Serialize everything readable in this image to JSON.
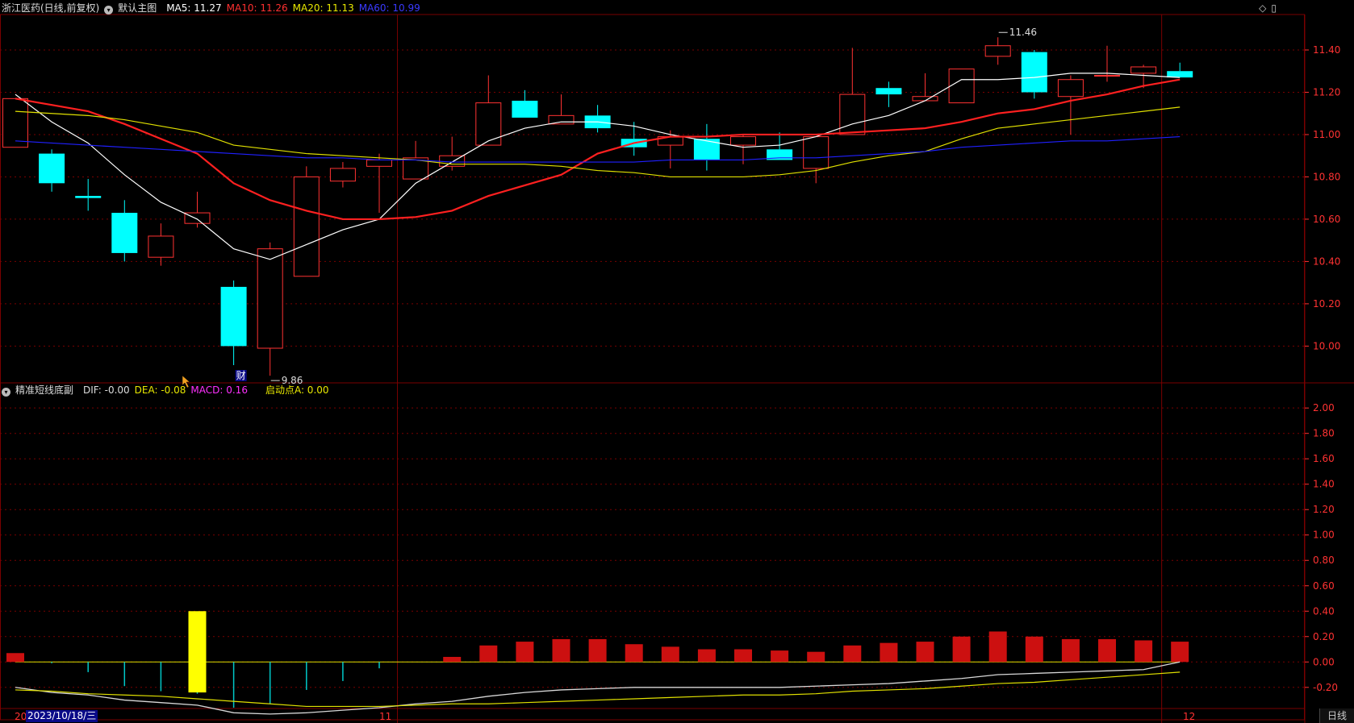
{
  "header": {
    "stock_name": "浙江医药(日线,前复权)",
    "main_chart_label": "默认主图",
    "ma5": "MA5: 11.27",
    "ma10": "MA10: 11.26",
    "ma20": "MA20: 11.13",
    "ma60": "MA60: 10.99"
  },
  "sub_header": {
    "indicator_name": "精准短线底副",
    "dif": "DIF: -0.00",
    "dea": "DEA: -0.08",
    "macd": "MACD: 0.16",
    "start_point": "启动点A: 0.00"
  },
  "footer": {
    "left_edge": "20",
    "cursor_date": "2023/10/18/三",
    "month_nov": "11",
    "month_dec": "12",
    "period_tab": "日线"
  },
  "colors": {
    "up": "#ff3232",
    "down": "#00ffff",
    "ma5": "#ffffff",
    "ma10": "#ff2020",
    "ma20": "#e0e000",
    "ma60": "#2020ff",
    "dif": "#d8d8d8",
    "dea": "#e0e000",
    "macd_pos": "#cc1010",
    "macd_neg": "#00c8c8",
    "signal": "#ffff00",
    "grid": "#7a0000",
    "axis_text": "#ff3232"
  },
  "icons": [
    "settings-circle-icon",
    "diamond-icon",
    "restore-window-icon"
  ],
  "chart_data": [
    {
      "type": "candlestick",
      "title": "浙江医药(日线,前复权)",
      "y_ticks": [
        "10.00",
        "10.20",
        "10.40",
        "10.60",
        "10.80",
        "11.00",
        "11.20",
        "11.40"
      ],
      "ylim": [
        9.83,
        11.56
      ],
      "annotations": [
        {
          "text": "11.46",
          "candle": 27,
          "value": 11.46
        },
        {
          "text": "9.86",
          "candle": 7,
          "value": 9.86
        },
        {
          "text": "财",
          "candle": 6
        }
      ],
      "candles": [
        {
          "o": 10.94,
          "h": 11.17,
          "l": 10.94,
          "c": 11.17
        },
        {
          "o": 10.91,
          "h": 10.93,
          "l": 10.73,
          "c": 10.77
        },
        {
          "o": 10.71,
          "h": 10.79,
          "l": 10.64,
          "c": 10.7
        },
        {
          "o": 10.63,
          "h": 10.69,
          "l": 10.4,
          "c": 10.44
        },
        {
          "o": 10.42,
          "h": 10.58,
          "l": 10.38,
          "c": 10.52
        },
        {
          "o": 10.58,
          "h": 10.73,
          "l": 10.56,
          "c": 10.63
        },
        {
          "o": 10.28,
          "h": 10.31,
          "l": 9.91,
          "c": 10.0
        },
        {
          "o": 9.99,
          "h": 10.49,
          "l": 9.86,
          "c": 10.46
        },
        {
          "o": 10.33,
          "h": 10.85,
          "l": 10.33,
          "c": 10.8
        },
        {
          "o": 10.78,
          "h": 10.87,
          "l": 10.75,
          "c": 10.84
        },
        {
          "o": 10.85,
          "h": 10.91,
          "l": 10.63,
          "c": 10.88
        },
        {
          "o": 10.79,
          "h": 10.97,
          "l": 10.79,
          "c": 10.89
        },
        {
          "o": 10.85,
          "h": 10.99,
          "l": 10.83,
          "c": 10.9
        },
        {
          "o": 10.95,
          "h": 11.28,
          "l": 10.95,
          "c": 11.15
        },
        {
          "o": 11.16,
          "h": 11.21,
          "l": 11.08,
          "c": 11.08
        },
        {
          "o": 11.05,
          "h": 11.19,
          "l": 11.05,
          "c": 11.09
        },
        {
          "o": 11.09,
          "h": 11.14,
          "l": 11.01,
          "c": 11.03
        },
        {
          "o": 10.98,
          "h": 11.06,
          "l": 10.9,
          "c": 10.94
        },
        {
          "o": 10.95,
          "h": 11.02,
          "l": 10.84,
          "c": 10.99
        },
        {
          "o": 10.98,
          "h": 11.05,
          "l": 10.83,
          "c": 10.88
        },
        {
          "o": 10.95,
          "h": 11.0,
          "l": 10.86,
          "c": 10.99
        },
        {
          "o": 10.93,
          "h": 11.01,
          "l": 10.88,
          "c": 10.88
        },
        {
          "o": 10.84,
          "h": 10.99,
          "l": 10.77,
          "c": 10.99
        },
        {
          "o": 11.0,
          "h": 11.41,
          "l": 11.0,
          "c": 11.19
        },
        {
          "o": 11.22,
          "h": 11.25,
          "l": 11.13,
          "c": 11.19
        },
        {
          "o": 11.16,
          "h": 11.29,
          "l": 11.16,
          "c": 11.18
        },
        {
          "o": 11.15,
          "h": 11.31,
          "l": 11.15,
          "c": 11.31
        },
        {
          "o": 11.37,
          "h": 11.46,
          "l": 11.33,
          "c": 11.42
        },
        {
          "o": 11.39,
          "h": 11.4,
          "l": 11.17,
          "c": 11.2
        },
        {
          "o": 11.18,
          "h": 11.28,
          "l": 11.0,
          "c": 11.26
        },
        {
          "o": 11.28,
          "h": 11.42,
          "l": 11.25,
          "c": 11.28
        },
        {
          "o": 11.29,
          "h": 11.33,
          "l": 11.22,
          "c": 11.32
        },
        {
          "o": 11.3,
          "h": 11.34,
          "l": 11.27,
          "c": 11.27
        }
      ],
      "series": [
        {
          "name": "MA5",
          "values": [
            11.19,
            11.06,
            10.96,
            10.81,
            10.68,
            10.6,
            10.46,
            10.41,
            10.48,
            10.55,
            10.6,
            10.77,
            10.87,
            10.97,
            11.03,
            11.06,
            11.06,
            11.04,
            11.0,
            10.97,
            10.94,
            10.95,
            10.99,
            11.05,
            11.09,
            11.16,
            11.26,
            11.26,
            11.27,
            11.29,
            11.29,
            11.28,
            11.27
          ]
        },
        {
          "name": "MA10",
          "values": [
            11.17,
            11.14,
            11.11,
            11.05,
            10.98,
            10.91,
            10.77,
            10.69,
            10.64,
            10.6,
            10.6,
            10.61,
            10.64,
            10.71,
            10.76,
            10.81,
            10.91,
            10.96,
            10.99,
            10.99,
            11.0,
            11.0,
            11.0,
            11.01,
            11.02,
            11.03,
            11.06,
            11.1,
            11.12,
            11.16,
            11.19,
            11.23,
            11.26
          ]
        },
        {
          "name": "MA20",
          "values": [
            11.11,
            11.1,
            11.09,
            11.07,
            11.04,
            11.01,
            10.95,
            10.93,
            10.91,
            10.9,
            10.89,
            10.88,
            10.86,
            10.86,
            10.86,
            10.85,
            10.83,
            10.82,
            10.8,
            10.8,
            10.8,
            10.81,
            10.83,
            10.87,
            10.9,
            10.92,
            10.98,
            11.03,
            11.05,
            11.07,
            11.09,
            11.11,
            11.13
          ]
        },
        {
          "name": "MA60",
          "values": [
            10.97,
            10.96,
            10.95,
            10.94,
            10.93,
            10.92,
            10.91,
            10.9,
            10.89,
            10.89,
            10.88,
            10.88,
            10.87,
            10.87,
            10.87,
            10.87,
            10.87,
            10.87,
            10.88,
            10.88,
            10.88,
            10.89,
            10.89,
            10.9,
            10.91,
            10.92,
            10.94,
            10.95,
            10.96,
            10.97,
            10.97,
            10.98,
            10.99
          ]
        }
      ]
    },
    {
      "type": "bar",
      "title": "精准短线底副",
      "y_ticks": [
        "-0.20",
        "0.00",
        "0.20",
        "0.40",
        "0.60",
        "0.80",
        "1.00",
        "1.20",
        "1.40",
        "1.60",
        "1.80",
        "2.00"
      ],
      "ylim": [
        -0.36,
        2.09
      ],
      "macd_values": [
        0.07,
        -0.01,
        -0.08,
        -0.19,
        -0.23,
        -0.25,
        -0.36,
        -0.33,
        -0.22,
        -0.15,
        -0.05,
        0.0,
        0.04,
        0.13,
        0.16,
        0.18,
        0.18,
        0.14,
        0.12,
        0.1,
        0.1,
        0.09,
        0.08,
        0.13,
        0.15,
        0.16,
        0.2,
        0.24,
        0.2,
        0.18,
        0.18,
        0.17,
        0.16
      ],
      "signal_bar": {
        "candle": 5,
        "top": 0.4,
        "bottom": -0.24
      },
      "series": [
        {
          "name": "DIF",
          "values": [
            -0.2,
            -0.24,
            -0.26,
            -0.3,
            -0.32,
            -0.34,
            -0.4,
            -0.41,
            -0.4,
            -0.38,
            -0.36,
            -0.33,
            -0.31,
            -0.27,
            -0.24,
            -0.22,
            -0.21,
            -0.2,
            -0.2,
            -0.2,
            -0.2,
            -0.2,
            -0.19,
            -0.18,
            -0.17,
            -0.15,
            -0.13,
            -0.1,
            -0.09,
            -0.08,
            -0.07,
            -0.06,
            -0.0
          ]
        },
        {
          "name": "DEA",
          "values": [
            -0.22,
            -0.23,
            -0.25,
            -0.26,
            -0.27,
            -0.29,
            -0.31,
            -0.33,
            -0.35,
            -0.35,
            -0.35,
            -0.34,
            -0.33,
            -0.33,
            -0.32,
            -0.31,
            -0.3,
            -0.29,
            -0.28,
            -0.27,
            -0.26,
            -0.26,
            -0.25,
            -0.23,
            -0.22,
            -0.21,
            -0.19,
            -0.17,
            -0.16,
            -0.14,
            -0.12,
            -0.1,
            -0.08
          ]
        }
      ]
    }
  ]
}
